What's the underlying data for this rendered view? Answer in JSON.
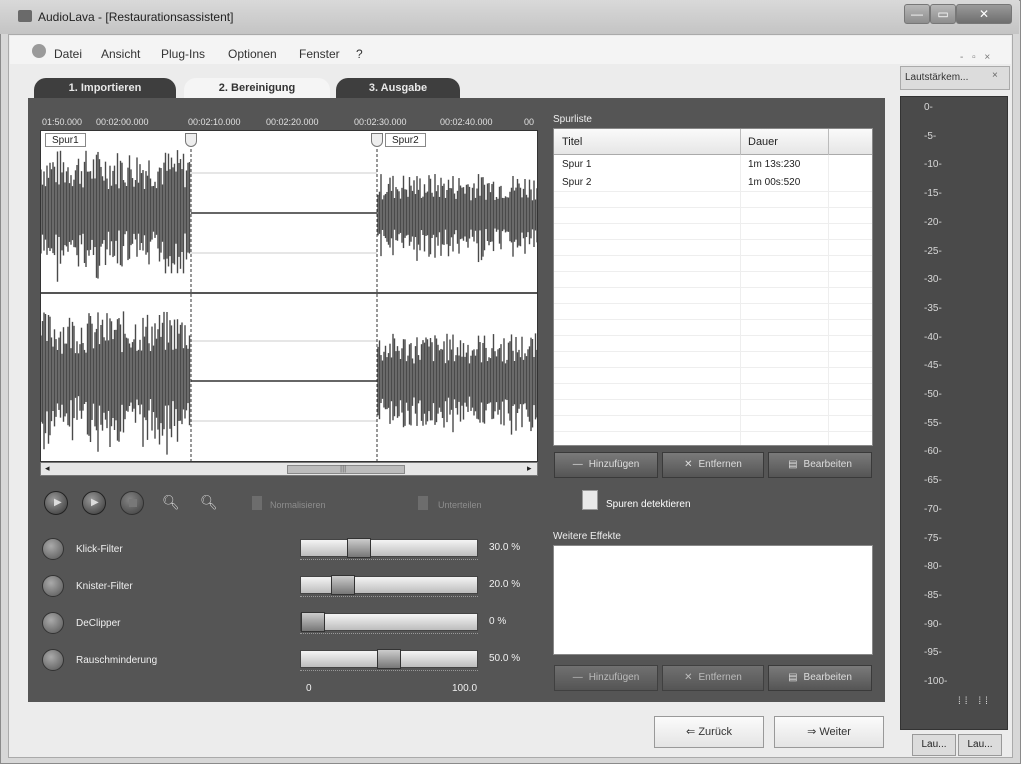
{
  "window": {
    "title": "AudioLava - [Restaurationsassistent]",
    "controls": {
      "minimize": "—",
      "maximize": "▭",
      "close": "✕"
    }
  },
  "menu": {
    "items": [
      "Datei",
      "Ansicht",
      "Plug-Ins",
      "Optionen",
      "Fenster",
      "?"
    ],
    "mdi_controls": "- ▫ ×"
  },
  "tabs": [
    "1. Importieren",
    "2. Bereinigung",
    "3. Ausgabe"
  ],
  "timeline": {
    "labels": [
      "01:50.000",
      "00:02:00.000",
      "00:02:10.000",
      "00:02:20.000",
      "00:02:30.000",
      "00:02:40.000",
      "00"
    ]
  },
  "tracks": {
    "marker1": "Spur1",
    "marker2": "Spur2"
  },
  "scrollbar": {
    "thumb_glyph": "|||"
  },
  "transport": {
    "normalize_label": "Normalisieren",
    "split_label": "Unterteilen",
    "detect_label": "Spuren detektieren"
  },
  "tracklist": {
    "title": "Spurliste",
    "columns": [
      "Titel",
      "Dauer"
    ],
    "rows": [
      {
        "title": "Spur 1",
        "duration": "1m 13s:230"
      },
      {
        "title": "Spur 2",
        "duration": "1m 00s:520"
      }
    ],
    "buttons": {
      "add": "Hinzufügen",
      "remove": "Entfernen",
      "edit": "Bearbeiten"
    }
  },
  "filters": [
    {
      "label": "Klick-Filter",
      "value": "30.0 %",
      "level": 30
    },
    {
      "label": "Knister-Filter",
      "value": "20.0 %",
      "level": 20
    },
    {
      "label": "DeClipper",
      "value": "0 %",
      "level": 0
    },
    {
      "label": "Rauschminderung",
      "value": "50.0 %",
      "level": 50
    }
  ],
  "slider_scale": {
    "min": "0",
    "max": "100.0"
  },
  "effects": {
    "title": "Weitere Effekte",
    "buttons": {
      "add": "Hinzufügen",
      "remove": "Entfernen",
      "edit": "Bearbeiten"
    }
  },
  "navigation": {
    "back": "⇐ Zurück",
    "next": "⇒ Weiter"
  },
  "meter": {
    "title": "Lautstärkem...",
    "close": "×",
    "scale": [
      "0-",
      "-5-",
      "-10-",
      "-15-",
      "-20-",
      "-25-",
      "-30-",
      "-35-",
      "-40-",
      "-45-",
      "-50-",
      "-55-",
      "-60-",
      "-65-",
      "-70-",
      "-75-",
      "-80-",
      "-85-",
      "-90-",
      "-95-",
      "-100-"
    ],
    "tabs": [
      "Lau...",
      "Lau..."
    ]
  }
}
